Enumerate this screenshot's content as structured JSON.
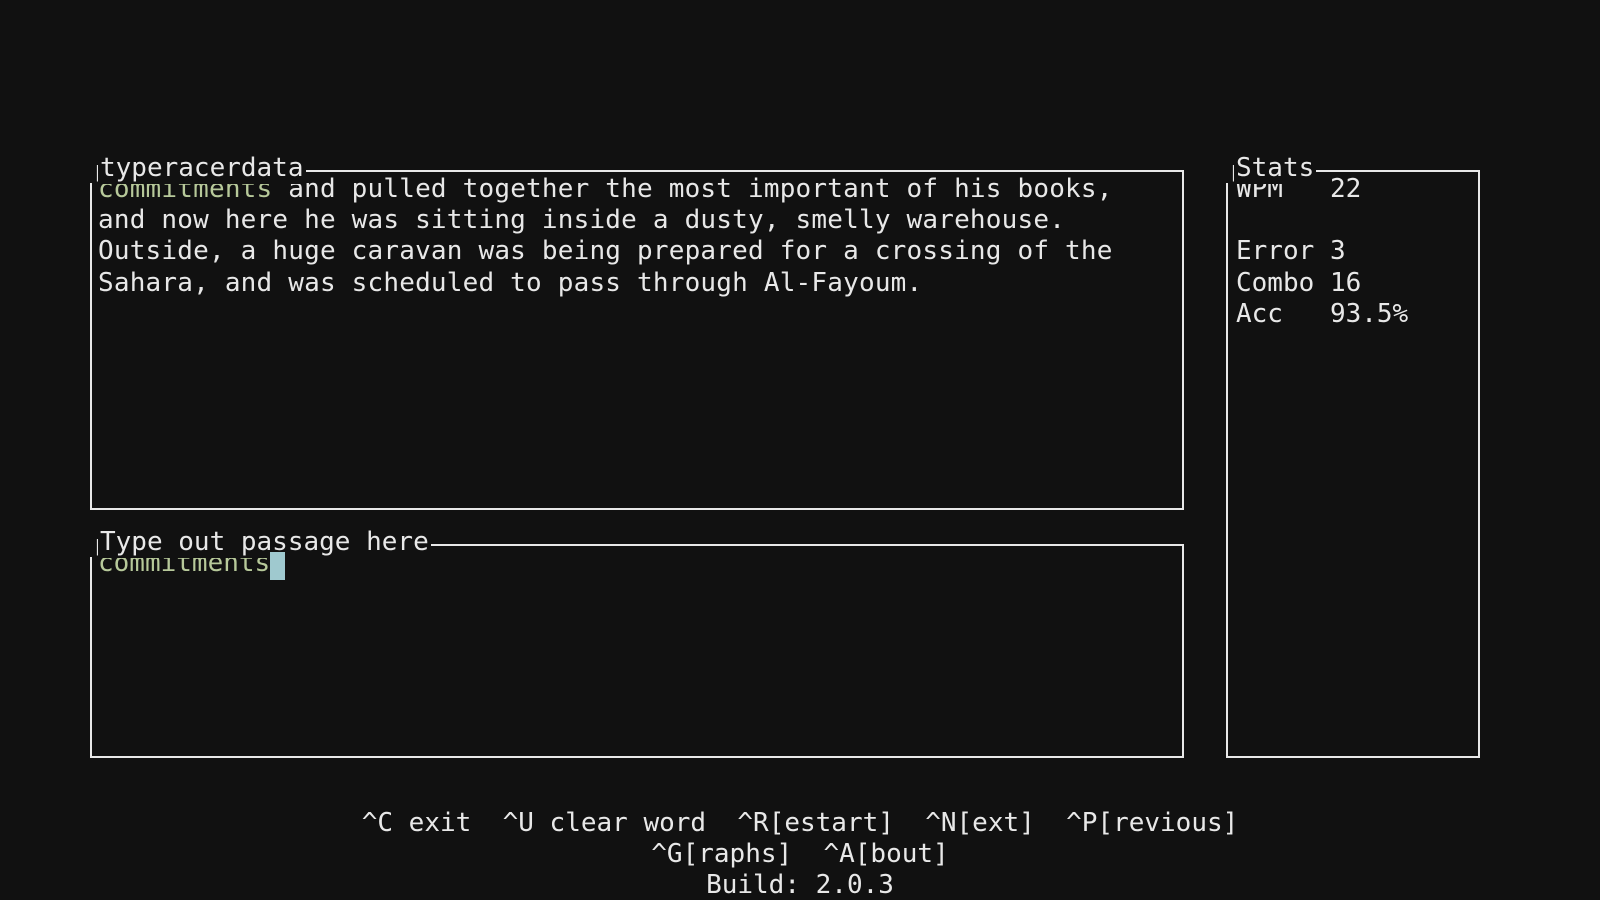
{
  "passage": {
    "title": "typeracerdata",
    "typed_text": "commitments",
    "remaining_text": " and pulled together the most important of his books, and now here he was sitting inside a dusty, smelly warehouse. Outside, a huge caravan was being prepared for a crossing of the Sahara, and was scheduled to pass through Al-Fayoum."
  },
  "input": {
    "title": "Type out passage here",
    "typed_text": "commitments"
  },
  "stats": {
    "title": "Stats",
    "wpm_label": "WPM",
    "wpm_value": "22",
    "error_label": "Error",
    "error_value": "3",
    "combo_label": "Combo",
    "combo_value": "16",
    "acc_label": "Acc",
    "acc_value": "93.5%"
  },
  "footer": {
    "line1": "^C exit  ^U clear word  ^R[estart]  ^N[ext]  ^P[revious]",
    "line2": "^G[raphs]  ^A[bout]",
    "build_label": "Build: ",
    "build_version": "2.0.3"
  }
}
